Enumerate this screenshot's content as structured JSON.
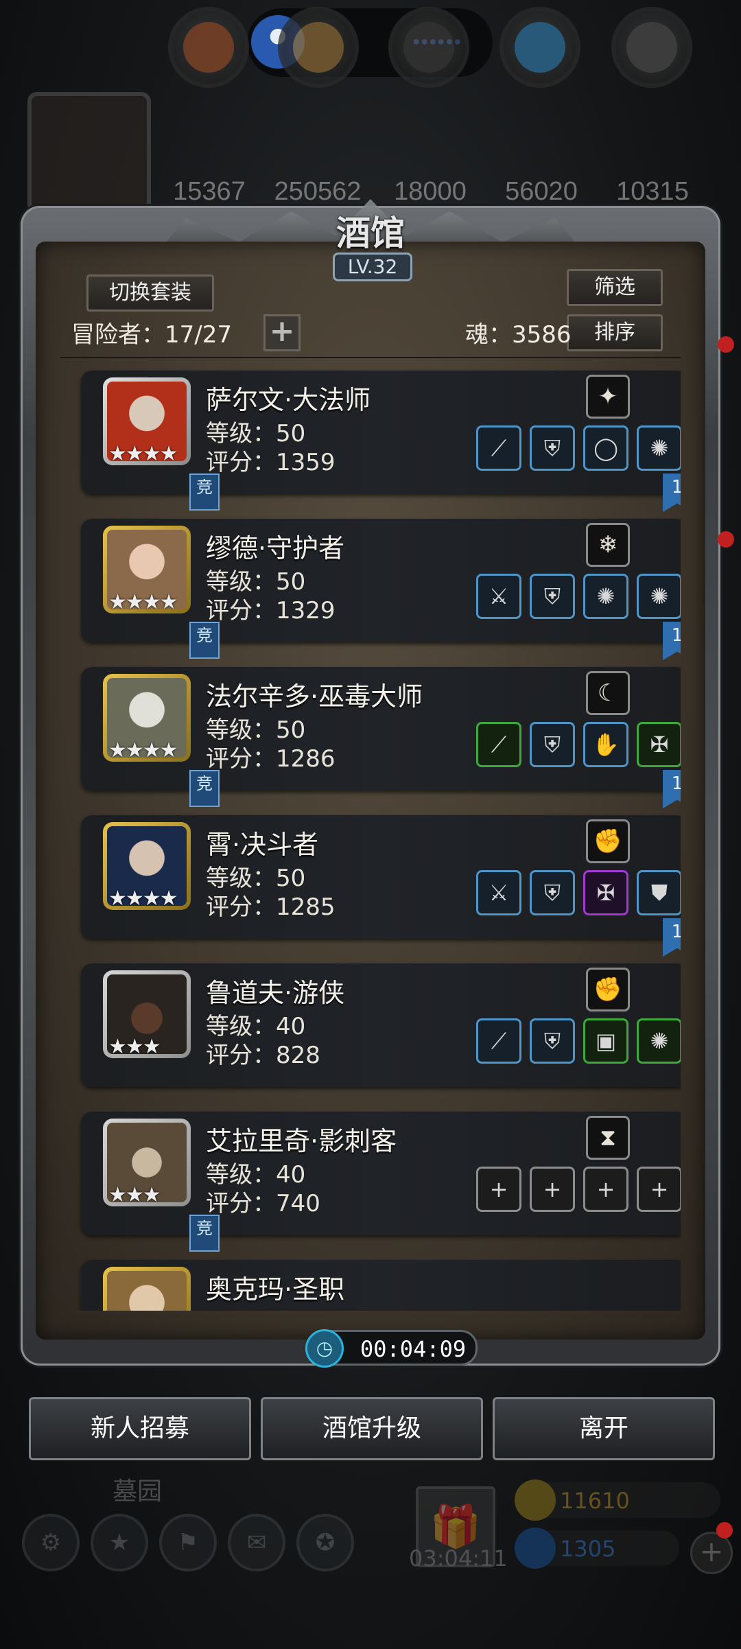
{
  "colors": {
    "accent_blue": "#4f95c7",
    "green_equip": "#3ea83c",
    "purple_equip": "#a23ad2",
    "gold": "#c9a030",
    "gem": "#3a86e0"
  },
  "status_bar": {
    "dots": "••••••"
  },
  "resources": [
    "15367",
    "250562",
    "18000",
    "56020",
    "10315"
  ],
  "tavern": {
    "title": "酒馆",
    "level": "LV.32",
    "switch_outfit": "切换套装",
    "filter": "筛选",
    "sort": "排序",
    "adventurers": "冒险者：17/27",
    "plus": "+",
    "soul": "魂：3586"
  },
  "heroes": [
    {
      "name": "萨尔文·大法师",
      "level": "等级：50",
      "score": "评分：1359",
      "stars": "★★★★",
      "tag": "竞",
      "bookmark": "1"
    },
    {
      "name": "缪德·守护者",
      "level": "等级：50",
      "score": "评分：1329",
      "stars": "★★★★",
      "tag": "竞",
      "bookmark": "1"
    },
    {
      "name": "法尔辛多·巫毒大师",
      "level": "等级：50",
      "score": "评分：1286",
      "stars": "★★★★",
      "tag": "竞",
      "bookmark": "1"
    },
    {
      "name": "霄·决斗者",
      "level": "等级：50",
      "score": "评分：1285",
      "stars": "★★★★",
      "tag": "",
      "bookmark": "1"
    },
    {
      "name": "鲁道夫·游侠",
      "level": "等级：40",
      "score": "评分：828",
      "stars": "★★★",
      "tag": "",
      "bookmark": ""
    },
    {
      "name": "艾拉里奇·影刺客",
      "level": "等级：40",
      "score": "评分：740",
      "stars": "★★★",
      "tag": "竞",
      "bookmark": ""
    },
    {
      "name": "奥克玛·圣职",
      "level": "",
      "score": "",
      "stars": "",
      "tag": "",
      "bookmark": ""
    }
  ],
  "timer": "00:04:09",
  "actions": {
    "recruit": "新人招募",
    "upgrade": "酒馆升级",
    "leave": "离开"
  },
  "bottom": {
    "cemetery": "墓园",
    "gift_timer": "03:04:11",
    "gold": "11610",
    "gems": "1305"
  }
}
